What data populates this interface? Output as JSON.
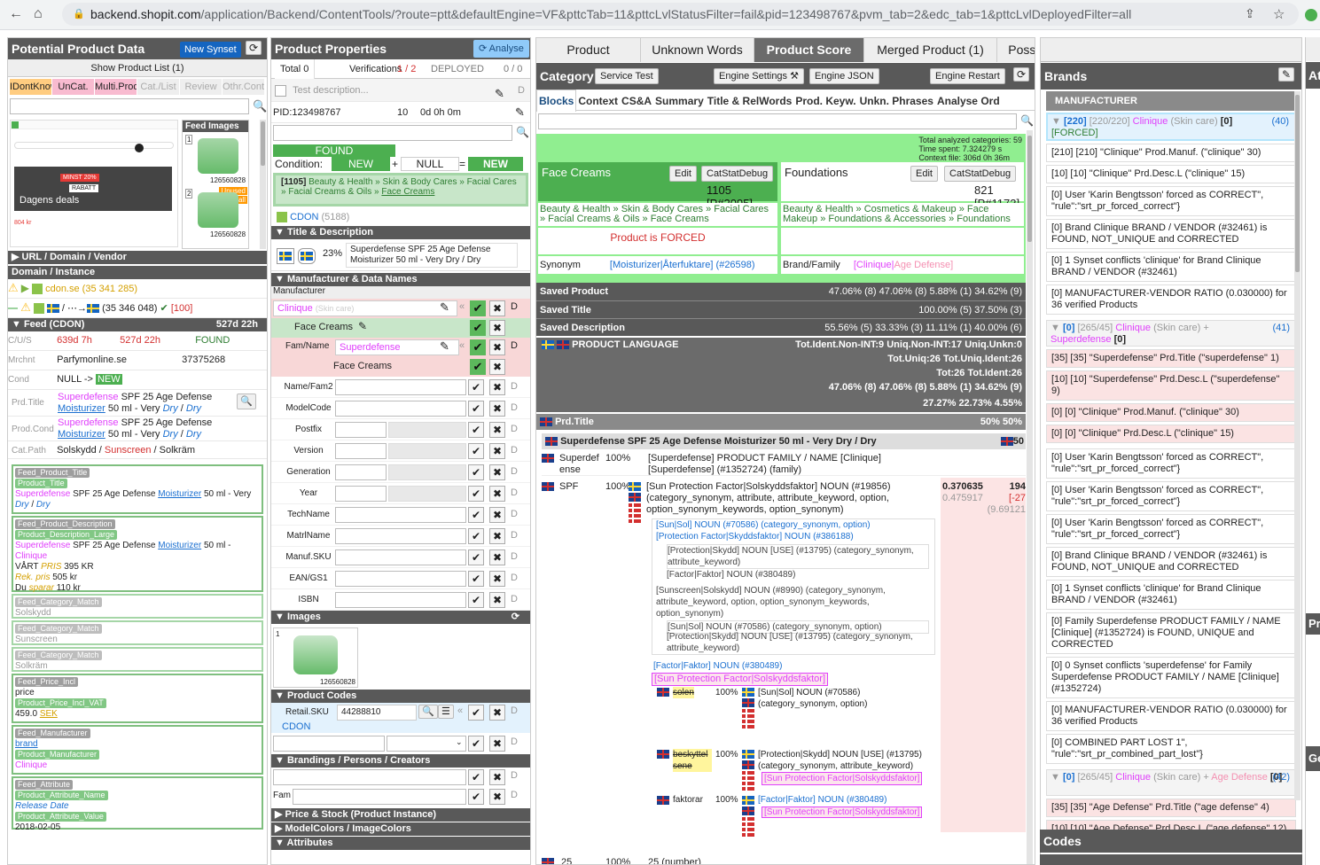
{
  "browser": {
    "url_host": "backend.shopit.com",
    "url_rest": "/application/Backend/ContentTools/?route=ptt&defaultEngine=VF&pttcTab=11&pttcLvlStatusFilter=fail&pid=123498767&pvm_tab=2&edc_tab=1&pttcLvlDeployedFilter=all"
  },
  "left": {
    "title": "Potential Product Data",
    "new_synset": "New Synset",
    "show_list": "Show Product List (1)",
    "filters": [
      "IDontKnow",
      "UnCat.",
      "Multi.Prod",
      "Cat./List",
      "Review",
      "Othr.Cont"
    ],
    "feed_images_label": "Feed Images",
    "thumb_ids": [
      "126560828",
      "126560828"
    ],
    "unused": "Unused",
    "small": "Small",
    "dagens_deals": "Dagens deals",
    "minst": "MINST 20%",
    "rabatt": "RABATT",
    "price_small": "804 kr",
    "url_section": "URL / Domain / Vendor",
    "domain_section": "Domain / Instance",
    "domain1": "cdon.se (35 341 285)",
    "domain2": "(35 346 048)",
    "domain2_count": "[100]",
    "feed_section": "Feed (CDON)",
    "feed_age": "527d 22h",
    "cus_label": "C/U/S",
    "cus_v1": "639d 7h",
    "cus_v2": "527d 22h",
    "cus_status": "FOUND",
    "mrchnt_label": "Mrchnt",
    "mrchnt_name": "Parfymonline.se",
    "mrchnt_id": "37375268",
    "cond_label": "Cond",
    "cond_value": "NULL ->",
    "cond_new": "NEW",
    "prdtitle_label": "Prd.Title",
    "prodcond_label": "Prod.Cond",
    "t_superdefense": "Superdefense",
    "t_spf": "SPF 25 Age Defense",
    "t_moist": "Moisturizer",
    "t_50ml": "50 ml - Very",
    "t_dry": "Dry",
    "t_slash": "/",
    "catpath_label": "Cat.Path",
    "cat1": "Solskydd",
    "cat2": "Sunscreen",
    "cat3": "Solkräm",
    "boxes": {
      "fpt": "Feed_Product_Title",
      "pt": "Product_Title",
      "pt_line": "SPF 25 Age Defense",
      "pt_mid": "50 ml - Very",
      "fpd": "Feed_Product_Description",
      "pdl": "Product_Description_Large",
      "pd_mid": "50 ml -",
      "pd_clinique": "Clinique",
      "pd_vart": "VÅRT",
      "pd_pris": "PRIS",
      "pd_395": "395 KR",
      "rek": "Rek. pris",
      "rek_v": "505 kr",
      "du": "Du",
      "sparar": "sparar",
      "du_v": "110 kr",
      "fcm": "Feed_Category_Match",
      "fcm1": "Solskydd",
      "fcm2": "Sunscreen",
      "fcm3": "Solkräm",
      "fpi": "Feed_Price_Incl",
      "price": "price",
      "ppiv": "Product_Price_Incl_VAT",
      "price_v": "459.0",
      "sek": "SEK",
      "fm": "Feed_Manufacturer",
      "brand": "brand",
      "pm": "Product_Manufacturer",
      "clinique": "Clinique",
      "fa": "Feed_Attribute",
      "pan": "Product_Attribute_Name",
      "release": "Release Date",
      "pav": "Product_Attribute_Value",
      "date": "2018-02-05"
    }
  },
  "props": {
    "title": "Product Properties",
    "analyse": "Analyse",
    "total": "Total 0",
    "verif": "Verifications",
    "verif_v": "1 / 2",
    "deployed": "DEPLOYED",
    "deployed_v": "0 / 0",
    "test_desc": "Test description...",
    "pid": "PID:123498767",
    "pid_n": "10",
    "pid_t": "0d 0h 0m",
    "found": "FOUND",
    "cond": "Condition:",
    "new1": "NEW",
    "plus": "+",
    "null": "NULL",
    "eq": "=",
    "new2": "NEW",
    "catpath_id": "[1105]",
    "catpath": "Beauty & Health » Skin & Body Cares » Facial Cares » Facial Creams & Oils »",
    "catpath_link": "Face Creams",
    "cdon": "CDON",
    "cdon_n": "(5188)",
    "td_section": "Title & Description",
    "td_pct": "23%",
    "td_text": "Superdefense SPF 25 Age Defense Moisturizer 50 ml - Very Dry / Dry",
    "mdn_section": "Manufacturer & Data Names",
    "manu_label": "Manufacturer",
    "manu_val": "Clinique",
    "manu_hint": "(Skin care)",
    "face_creams": "Face Creams",
    "famname": "Fam/Name",
    "fam_val": "Superdefense",
    "fields": [
      "Name/Fam2",
      "ModelCode",
      "Postfix",
      "Version",
      "Generation",
      "Year",
      "TechName",
      "MatrlName",
      "Manuf.SKU",
      "EAN/GS1",
      "ISBN"
    ],
    "images_section": "Images",
    "img_id": "126560828",
    "codes_section": "Product Codes",
    "retail": "Retail.SKU",
    "retail_v": "44288810",
    "codes_cdon": "CDON",
    "brand_section": "Brandings / Persons / Creators",
    "fam": "Fam",
    "price_section": "Price & Stock (Product Instance)",
    "colors_section": "ModelColors / ImageColors",
    "attr_section": "Attributes"
  },
  "score": {
    "tabs": [
      "Product",
      "Unknown Words",
      "Product Score",
      "Merged Product (1)",
      "Possible Merges (0)",
      "Variants (0)"
    ],
    "category": "Category",
    "service_test": "Service Test",
    "engine_settings": "Engine Settings",
    "engine_json": "Engine JSON",
    "engine_restart": "Engine Restart",
    "subtabs": [
      "Blocks",
      "Context",
      "CS&A",
      "Summary",
      "Title & RelWords",
      "Prod. Keyw.",
      "Unkn. Phrases",
      "Analyse Ord"
    ],
    "stats": [
      "Total analyzed categories: 59",
      "Time spent: 7.324279 s",
      "Context file: 306d 0h 36m"
    ],
    "cat1_name": "Face Creams",
    "cat1_score": "1105 [P#2095]",
    "cat2_name": "Foundations",
    "cat2_score": "821 [P#1173]",
    "edit": "Edit",
    "catstat": "CatStatDebug",
    "cat1_path": "Beauty & Health » Skin & Body Cares » Facial Cares » Facial Creams & Oils » Face Creams",
    "cat2_path": "Beauty & Health » Cosmetics & Makeup » Face Makeup » Foundations & Accessories » Foundations",
    "forced": "Product is FORCED",
    "synonym": "Synonym",
    "syn_val": "[Moisturizer|Återfuktare] (#26598)",
    "brandfam": "Brand/Family",
    "brandfam_val1": "[Clinique|",
    "brandfam_val2": "Age Defense]",
    "saved_product": "Saved Product",
    "saved_product_v": "47.06% (8)  47.06% (8)  5.88% (1)  34.62% (9)",
    "saved_title": "Saved Title",
    "saved_title_v": "100.00% (5)  37.50% (3)",
    "saved_desc": "Saved Description",
    "saved_desc_v": "55.56% (5)  33.33% (3)  11.11% (1)  40.00% (6)",
    "prodlang": "PRODUCT LANGUAGE",
    "lang_r1": "Tot.Ident.Non-INT:9   Uniq.Non-INT:17   Uniq.Unkn:0",
    "lang_r2": "Tot.Uniq:26   Tot.Uniq.Ident:26",
    "lang_r3": "Tot:26   Tot.Ident:26",
    "lang_r4": "47.06% (8)  47.06% (8)  5.88% (1)  34.62% (9)",
    "lang_r5": "27.27%  22.73%  4.55%",
    "prdtitle": "Prd.Title",
    "prdtitle_v": "50%   50%",
    "title_line": "Superdefense SPF 25 Age Defense Moisturizer 50 ml - Very Dry / Dry",
    "title_pct": "50",
    "w1": "Superdefense",
    "w1_pct": "100%",
    "w1_text": "[Superdefense] PRODUCT FAMILY / NAME [Clinique] [Superdefense] (#1352724) (family)",
    "w2": "SPF",
    "w2_pct": "100%",
    "w2_text": "[Sun Protection Factor|Solskyddsfaktor] NOUN (#19856) (category_synonym, attribute, attribute_keyword, option, option_synonym_keywords, option_synonym)",
    "w2_s1": "0.370635",
    "w2_s2": "0.475917",
    "w2_s3": "194",
    "w2_s4": "[-27",
    "w2_s5": "(9.69121",
    "n1": "[Sun|Sol] NOUN (#70586) (category_synonym, option)",
    "n2": "[Protection Factor|Skyddsfaktor] NOUN (#386188)",
    "n3": "[Protection|Skydd] NOUN [USE] (#13795) (category_synonym, attribute_keyword)",
    "n4": "[Factor|Faktor] NOUN (#380489)",
    "n5": "[Sunscreen|Solskydd] NOUN (#8990) (category_synonym, attribute_keyword, option, option_synonym_keywords, option_synonym)",
    "n6": "[Sun|Sol] NOUN (#70586) (category_synonym, option)",
    "n7": "[Protection|Skydd] NOUN [USE] (#13795) (category_synonym, attribute_keyword)",
    "n8": "[Factor|Faktor] NOUN (#380489)",
    "spf_tag": "[Sun Protection Factor|Solskyddsfaktor]",
    "sub1": "solen",
    "sub1_pct": "100%",
    "sub1_text": "[Sun|Sol] NOUN (#70586) (category_synonym, option)",
    "sub2": "beskyttelsene",
    "sub2_pct": "100%",
    "sub2_text": "[Protection|Skydd] NOUN [USE] (#13795) (category_synonym, attribute_keyword)",
    "sub3": "faktorar",
    "sub3_pct": "100%",
    "sub3_text": "[Factor|Faktor] NOUN (#380489)",
    "last_w": "25",
    "last_pct": "100%",
    "last_text": "25 (number)"
  },
  "brands": {
    "title": "Brands",
    "manufacturer": "MANUFACTURER",
    "g1_head": "[220]",
    "g1_head2": "[220/220]",
    "g1_brand": "Clinique",
    "g1_cat": "(Skin care)",
    "g1_n": "[0]",
    "g1_count": "(40)",
    "g1_forced": "[FORCED]",
    "cards1": [
      "[210] [210] \"Clinique\" Prod.Manuf. (\"clinique\" 30)",
      "[10] [10] \"Clinique\" Prd.Desc.L (\"clinique\" 15)",
      "[0] User 'Karin Bengtsson' forced as CORRECT\", \"rule\":\"srt_pr_forced_correct\"}",
      "[0] Brand Clinique BRAND / VENDOR (#32461) is FOUND, NOT_UNIQUE and CORRECTED",
      "[0] 1 Synset conflicts 'clinique' for Brand Clinique BRAND / VENDOR (#32461)",
      "[0] MANUFACTURER-VENDOR RATIO (0.030000) for 36 verified Products"
    ],
    "g2_head": "[0]",
    "g2_head2": "[265/45]",
    "g2_brand": "Clinique",
    "g2_cat": "(Skin care) +",
    "g2_fam": "Superdefense",
    "g2_n": "[0]",
    "g2_count": "(41)",
    "cards2": [
      "[35] [35] \"Superdefense\" Prd.Title (\"superdefense\" 1)",
      "[10] [10] \"Superdefense\" Prd.Desc.L (\"superdefense\" 9)",
      "[0] [0] \"Clinique\" Prod.Manuf. (\"clinique\" 30)",
      "[0] [0] \"Clinique\" Prd.Desc.L (\"clinique\" 15)"
    ],
    "cards3": [
      "[0] User 'Karin Bengtsson' forced as CORRECT\", \"rule\":\"srt_pr_forced_correct\"}",
      "[0] User 'Karin Bengtsson' forced as CORRECT\", \"rule\":\"srt_pr_forced_correct\"}",
      "[0] User 'Karin Bengtsson' forced as CORRECT\", \"rule\":\"srt_pr_forced_correct\"}",
      "[0] Brand Clinique BRAND / VENDOR (#32461) is FOUND, NOT_UNIQUE and CORRECTED",
      "[0] 1 Synset conflicts 'clinique' for Brand Clinique BRAND / VENDOR (#32461)",
      "[0] Family Superdefense PRODUCT FAMILY / NAME [Clinique] (#1352724) is FOUND, UNIQUE and CORRECTED",
      "[0] 0 Synset conflicts 'superdefense' for Family Superdefense PRODUCT FAMILY / NAME [Clinique] (#1352724)",
      "[0] MANUFACTURER-VENDOR RATIO (0.030000) for 36 verified Products",
      "[0] COMBINED PART LOST 1\", \"rule\":\"srt_pr_combined_part_lost\"}"
    ],
    "g3_head": "[0]",
    "g3_head2": "[265/45]",
    "g3_brand": "Clinique",
    "g3_cat": "(Skin care) +",
    "g3_fam": "Age Defense",
    "g3_n": "[0]",
    "g3_count": "(42)",
    "cards4": [
      "[35] [35] \"Age Defense\" Prd.Title (\"age defense\" 4)",
      "[10] [10] \"Age Defense\" Prd.Desc.L (\"age defense\" 12)"
    ],
    "codes": "Codes",
    "right_at": "At",
    "right_pr": "Pr",
    "right_ge": "Ge"
  }
}
